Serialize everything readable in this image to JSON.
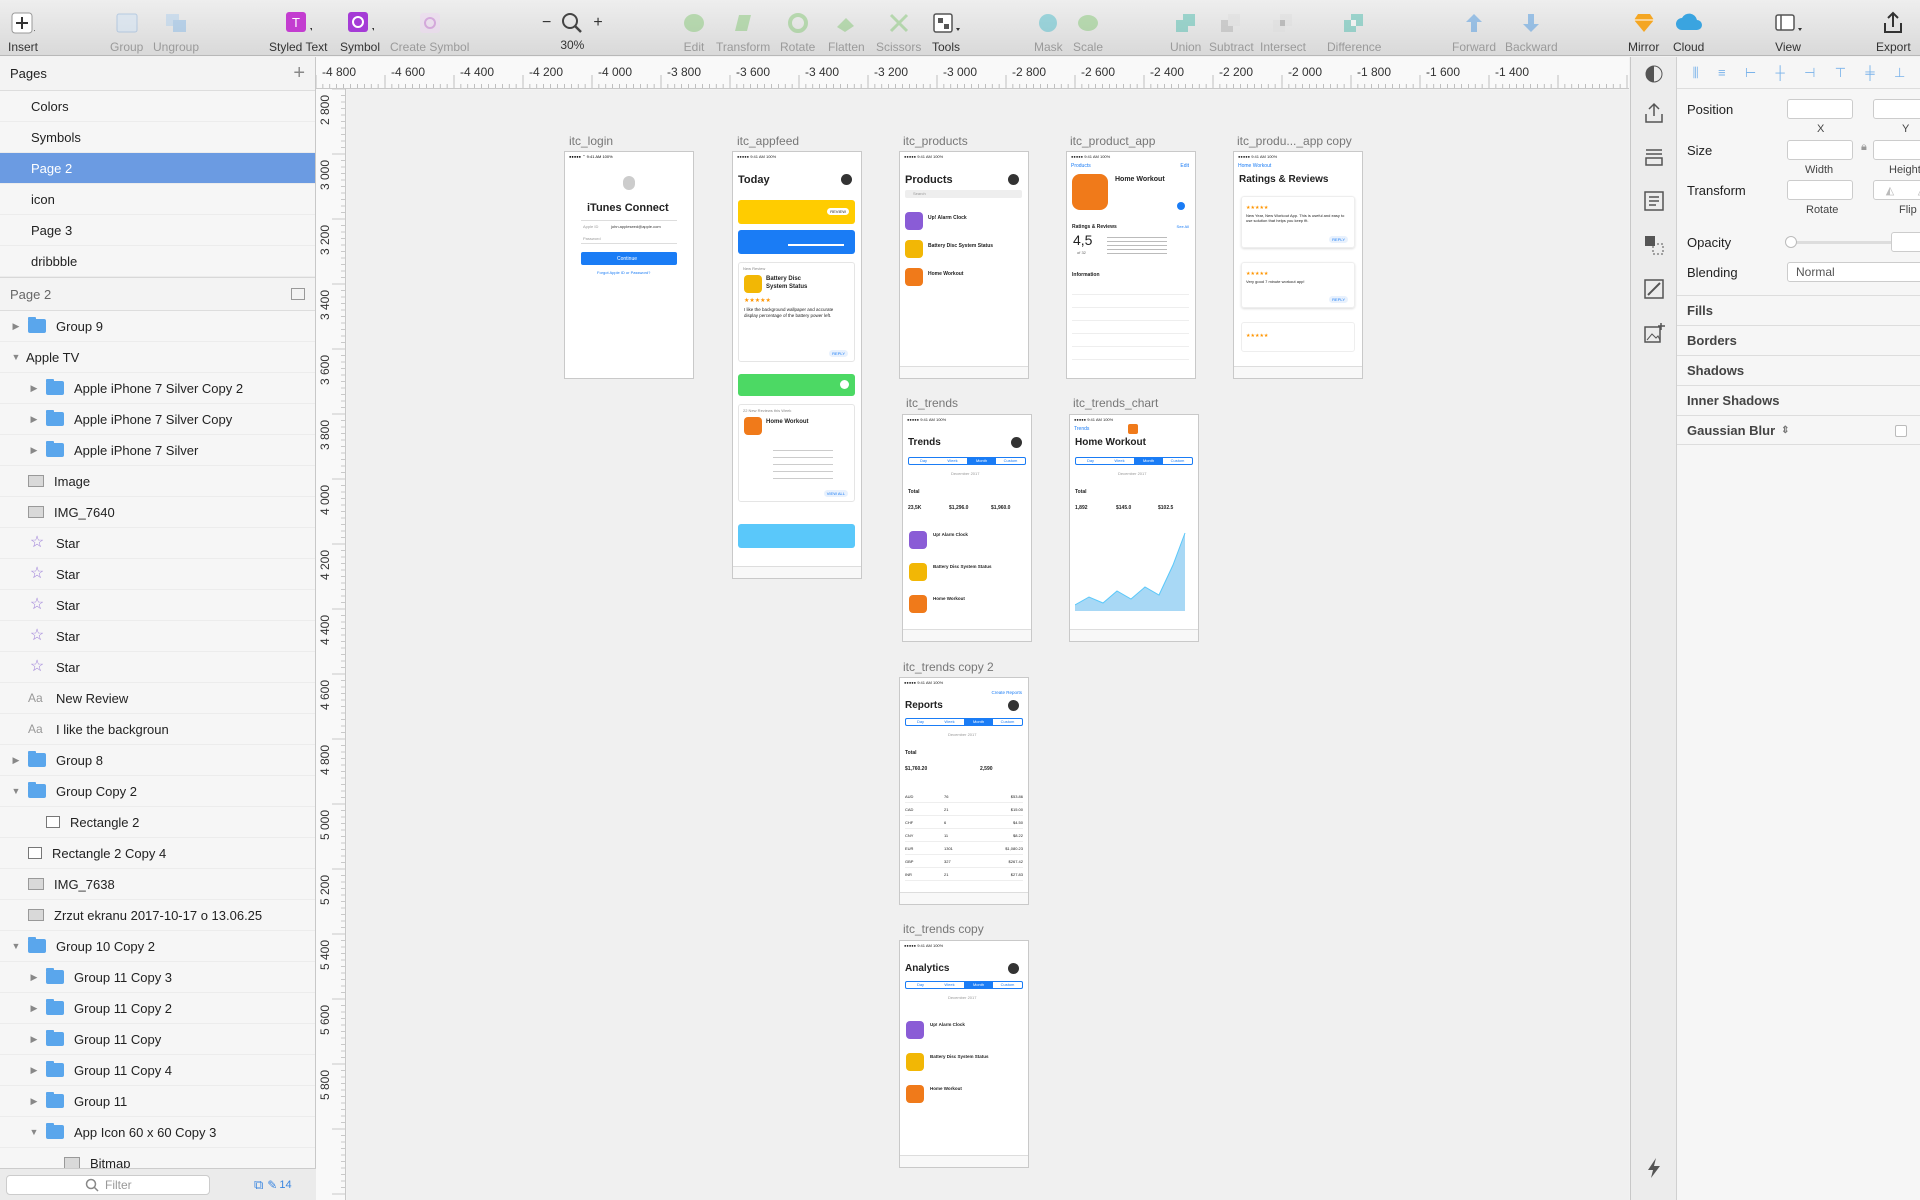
{
  "toolbar": {
    "insert": "Insert",
    "group": "Group",
    "ungroup": "Ungroup",
    "styled_text": "Styled Text",
    "symbol": "Symbol",
    "create_symbol": "Create Symbol",
    "zoom": "30%",
    "edit": "Edit",
    "transform": "Transform",
    "rotate": "Rotate",
    "flatten": "Flatten",
    "scissors": "Scissors",
    "tools": "Tools",
    "mask": "Mask",
    "scale": "Scale",
    "union": "Union",
    "subtract": "Subtract",
    "intersect": "Intersect",
    "difference": "Difference",
    "forward": "Forward",
    "backward": "Backward",
    "mirror": "Mirror",
    "cloud": "Cloud",
    "view": "View",
    "export": "Export"
  },
  "pages": {
    "header": "Pages",
    "items": [
      "Colors",
      "Symbols",
      "Page 2",
      "icon",
      "Page 3",
      "dribbble"
    ],
    "selected": "Page 2"
  },
  "layers": {
    "header": "Page 2",
    "items": [
      {
        "label": "Group 9",
        "type": "folder",
        "indent": 0,
        "arrow": "right"
      },
      {
        "label": "Apple TV",
        "type": "none",
        "indent": 0,
        "arrow": "down"
      },
      {
        "label": "Apple iPhone 7 Silver Copy 2",
        "type": "folder",
        "indent": 1,
        "arrow": "right"
      },
      {
        "label": "Apple iPhone 7 Silver Copy",
        "type": "folder",
        "indent": 1,
        "arrow": "right"
      },
      {
        "label": "Apple iPhone 7 Silver",
        "type": "folder",
        "indent": 1,
        "arrow": "right"
      },
      {
        "label": "Image",
        "type": "image",
        "indent": 0,
        "arrow": ""
      },
      {
        "label": "IMG_7640",
        "type": "image",
        "indent": 0,
        "arrow": ""
      },
      {
        "label": "Star",
        "type": "star",
        "indent": 0,
        "arrow": ""
      },
      {
        "label": "Star",
        "type": "star",
        "indent": 0,
        "arrow": ""
      },
      {
        "label": "Star",
        "type": "star",
        "indent": 0,
        "arrow": ""
      },
      {
        "label": "Star",
        "type": "star",
        "indent": 0,
        "arrow": ""
      },
      {
        "label": "Star",
        "type": "star",
        "indent": 0,
        "arrow": ""
      },
      {
        "label": "New Review",
        "type": "text",
        "indent": 0,
        "arrow": ""
      },
      {
        "label": "I like the backgroun",
        "type": "text",
        "indent": 0,
        "arrow": ""
      },
      {
        "label": "Group 8",
        "type": "folder",
        "indent": 0,
        "arrow": "right"
      },
      {
        "label": "Group Copy 2",
        "type": "folder",
        "indent": 0,
        "arrow": "down"
      },
      {
        "label": "Rectangle 2",
        "type": "rect",
        "indent": 1,
        "arrow": ""
      },
      {
        "label": "Rectangle 2 Copy 4",
        "type": "rect",
        "indent": 0,
        "arrow": ""
      },
      {
        "label": "IMG_7638",
        "type": "image",
        "indent": 0,
        "arrow": ""
      },
      {
        "label": "Zrzut ekranu 2017-10-17 o 13.06.25",
        "type": "image",
        "indent": 0,
        "arrow": ""
      },
      {
        "label": "Group 10 Copy 2",
        "type": "folder",
        "indent": 0,
        "arrow": "down"
      },
      {
        "label": "Group 11 Copy 3",
        "type": "folder",
        "indent": 1,
        "arrow": "right"
      },
      {
        "label": "Group 11 Copy 2",
        "type": "folder",
        "indent": 1,
        "arrow": "right"
      },
      {
        "label": "Group 11 Copy",
        "type": "folder",
        "indent": 1,
        "arrow": "right"
      },
      {
        "label": "Group 11 Copy 4",
        "type": "folder",
        "indent": 1,
        "arrow": "right"
      },
      {
        "label": "Group 11",
        "type": "folder",
        "indent": 1,
        "arrow": "right"
      },
      {
        "label": "App Icon 60 x 60 Copy 3",
        "type": "folder",
        "indent": 1,
        "arrow": "down"
      },
      {
        "label": "Bitmap",
        "type": "image",
        "indent": 2,
        "arrow": ""
      }
    ]
  },
  "filter": {
    "placeholder": "Filter",
    "count": "14"
  },
  "rulers": {
    "h": [
      "-4 800",
      "-4 600",
      "-4 400",
      "-4 200",
      "-4 000",
      "-3 800",
      "-3 600",
      "-3 400",
      "-3 200",
      "-3 000",
      "-2 800",
      "-2 600",
      "-2 400",
      "-2 200",
      "-2 000",
      "-1 800",
      "-1 600",
      "-1 400"
    ],
    "v": [
      "2 800",
      "3 000",
      "3 200",
      "3 400",
      "3 600",
      "3 800",
      "4 000",
      "4 200",
      "4 400",
      "4 600",
      "4 800",
      "5 000",
      "5 200",
      "5 400",
      "5 600",
      "5 800"
    ]
  },
  "artboards": {
    "login": {
      "name": "itc_login",
      "title": "iTunes Connect",
      "apple_id_label": "Apple ID",
      "apple_id_value": "john.appleseed@apple.com",
      "password": "Password",
      "continue": "Continue",
      "forgot": "Forgot Apple ID or Password?"
    },
    "appfeed": {
      "name": "itc_appfeed",
      "title": "Today",
      "review_btn": "REVIEW",
      "new_review": "New Review",
      "app": "Battery Disc System Status",
      "review_text": "I like the background wallpaper and accurate display percentage of the battery power left.",
      "reply": "REPLY",
      "new_reviews": "22 New Reviews this Week",
      "app2": "Home Workout",
      "view_all": "VIEW ALL"
    },
    "products": {
      "name": "itc_products",
      "title": "Products",
      "search": "Search",
      "apps": [
        "Up! Alarm Clock",
        "Battery Disc System Status",
        "Home Workout"
      ]
    },
    "product_app": {
      "name": "itc_product_app",
      "back": "Products",
      "edit": "Edit",
      "app": "Home Workout",
      "ratings": "Ratings & Reviews",
      "see_all": "See All",
      "score": "4,5",
      "of": "of 32",
      "info": "Information"
    },
    "product_app_copy": {
      "name": "itc_produ..._app copy",
      "back": "Home Workout",
      "title": "Ratings & Reviews",
      "review1": "New Year, New Workout App. This is useful and easy to use solution that helps you keep fit.",
      "review2": "Very good 7 minute workout app!",
      "reply": "REPLY"
    },
    "trends": {
      "name": "itc_trends",
      "title": "Trends",
      "tabs": [
        "Day",
        "Week",
        "Month",
        "Custom"
      ],
      "month": "December 2017",
      "total": "Total",
      "units": "23,5K",
      "proceeds": "$1,296.0",
      "sales": "$1,960.0",
      "apps": [
        "Up! Alarm Clock",
        "Battery Disc System Status",
        "Home Workout"
      ]
    },
    "trends_chart": {
      "name": "itc_trends_chart",
      "back": "Trends",
      "title": "Home Workout",
      "tabs": [
        "Day",
        "Week",
        "Month",
        "Custom"
      ],
      "month": "December 2017",
      "total": "Total",
      "units": "1,892",
      "proceeds": "$145.0",
      "sales": "$102.5"
    },
    "trends_copy2": {
      "name": "itc_trends copy 2",
      "create": "Create Reports",
      "title": "Reports",
      "tabs": [
        "Day",
        "Week",
        "Month",
        "Custom"
      ],
      "month": "December 2017",
      "total": "Total",
      "proceeds": "$1,760.20",
      "units": "2,590",
      "rows": [
        [
          "AUD",
          "76",
          "$53.86"
        ],
        [
          "CAD",
          "21",
          "$15.00"
        ],
        [
          "CHF",
          "6",
          "$4.50"
        ],
        [
          "CNY",
          "11",
          "$8.22"
        ],
        [
          "EUR",
          "1301",
          "$1,080.23"
        ],
        [
          "GBP",
          "327",
          "$267.42"
        ],
        [
          "INR",
          "21",
          "$27.83"
        ]
      ]
    },
    "trends_copy": {
      "name": "itc_trends copy",
      "title": "Analytics",
      "tabs": [
        "Day",
        "Week",
        "Month",
        "Custom"
      ],
      "month": "December 2017",
      "apps": [
        "Up! Alarm Clock",
        "Battery Disc System Status",
        "Home Workout"
      ]
    }
  },
  "inspector": {
    "position": "Position",
    "x": "X",
    "y": "Y",
    "size": "Size",
    "width": "Width",
    "height": "Height",
    "transform": "Transform",
    "rotate": "Rotate",
    "flip": "Flip",
    "opacity": "Opacity",
    "blending": "Blending",
    "blending_value": "Normal",
    "fills": "Fills",
    "borders": "Borders",
    "shadows": "Shadows",
    "inner_shadows": "Inner Shadows",
    "gaussian_blur": "Gaussian Blur"
  },
  "colors": {
    "accent": "#6b9be2",
    "ios_blue": "#1a7cf5",
    "orange": "#f07a1a",
    "yellow": "#ffcc00",
    "green": "#4cd964",
    "light_blue": "#5ac8fa"
  }
}
